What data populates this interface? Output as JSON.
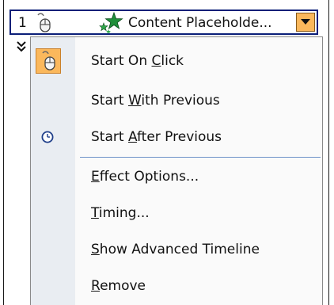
{
  "header": {
    "order_number": "1",
    "target_label": "Content Placeholde...",
    "icons": {
      "trigger": "mouse-click-icon",
      "effect": "green-star-effect-icon",
      "dropdown": "dropdown-arrow-icon"
    }
  },
  "menu": {
    "items": [
      {
        "id": "start-on-click",
        "before": "Start On ",
        "mnemonic": "C",
        "after": "lick",
        "icon": "mouse-click-icon",
        "selected": true
      },
      {
        "id": "start-with-previous",
        "before": "Start ",
        "mnemonic": "W",
        "after": "ith Previous",
        "icon": null,
        "selected": false
      },
      {
        "id": "start-after-previous",
        "before": "Start ",
        "mnemonic": "A",
        "after": "fter Previous",
        "icon": "clock-icon",
        "selected": false
      },
      {
        "id": "effect-options",
        "before": "",
        "mnemonic": "E",
        "after": "ffect Options...",
        "icon": null,
        "selected": false
      },
      {
        "id": "timing",
        "before": "",
        "mnemonic": "T",
        "after": "iming...",
        "icon": null,
        "selected": false
      },
      {
        "id": "show-advanced-timeline",
        "before": "",
        "mnemonic": "S",
        "after": "how Advanced Timeline",
        "icon": null,
        "selected": false
      },
      {
        "id": "remove",
        "before": "",
        "mnemonic": "R",
        "after": "emove",
        "icon": null,
        "selected": false
      }
    ]
  },
  "colors": {
    "selection_fill": "#fbb85c",
    "header_border": "#0b1f78",
    "separator": "#6e93c8",
    "gutter": "#e9edf2"
  }
}
